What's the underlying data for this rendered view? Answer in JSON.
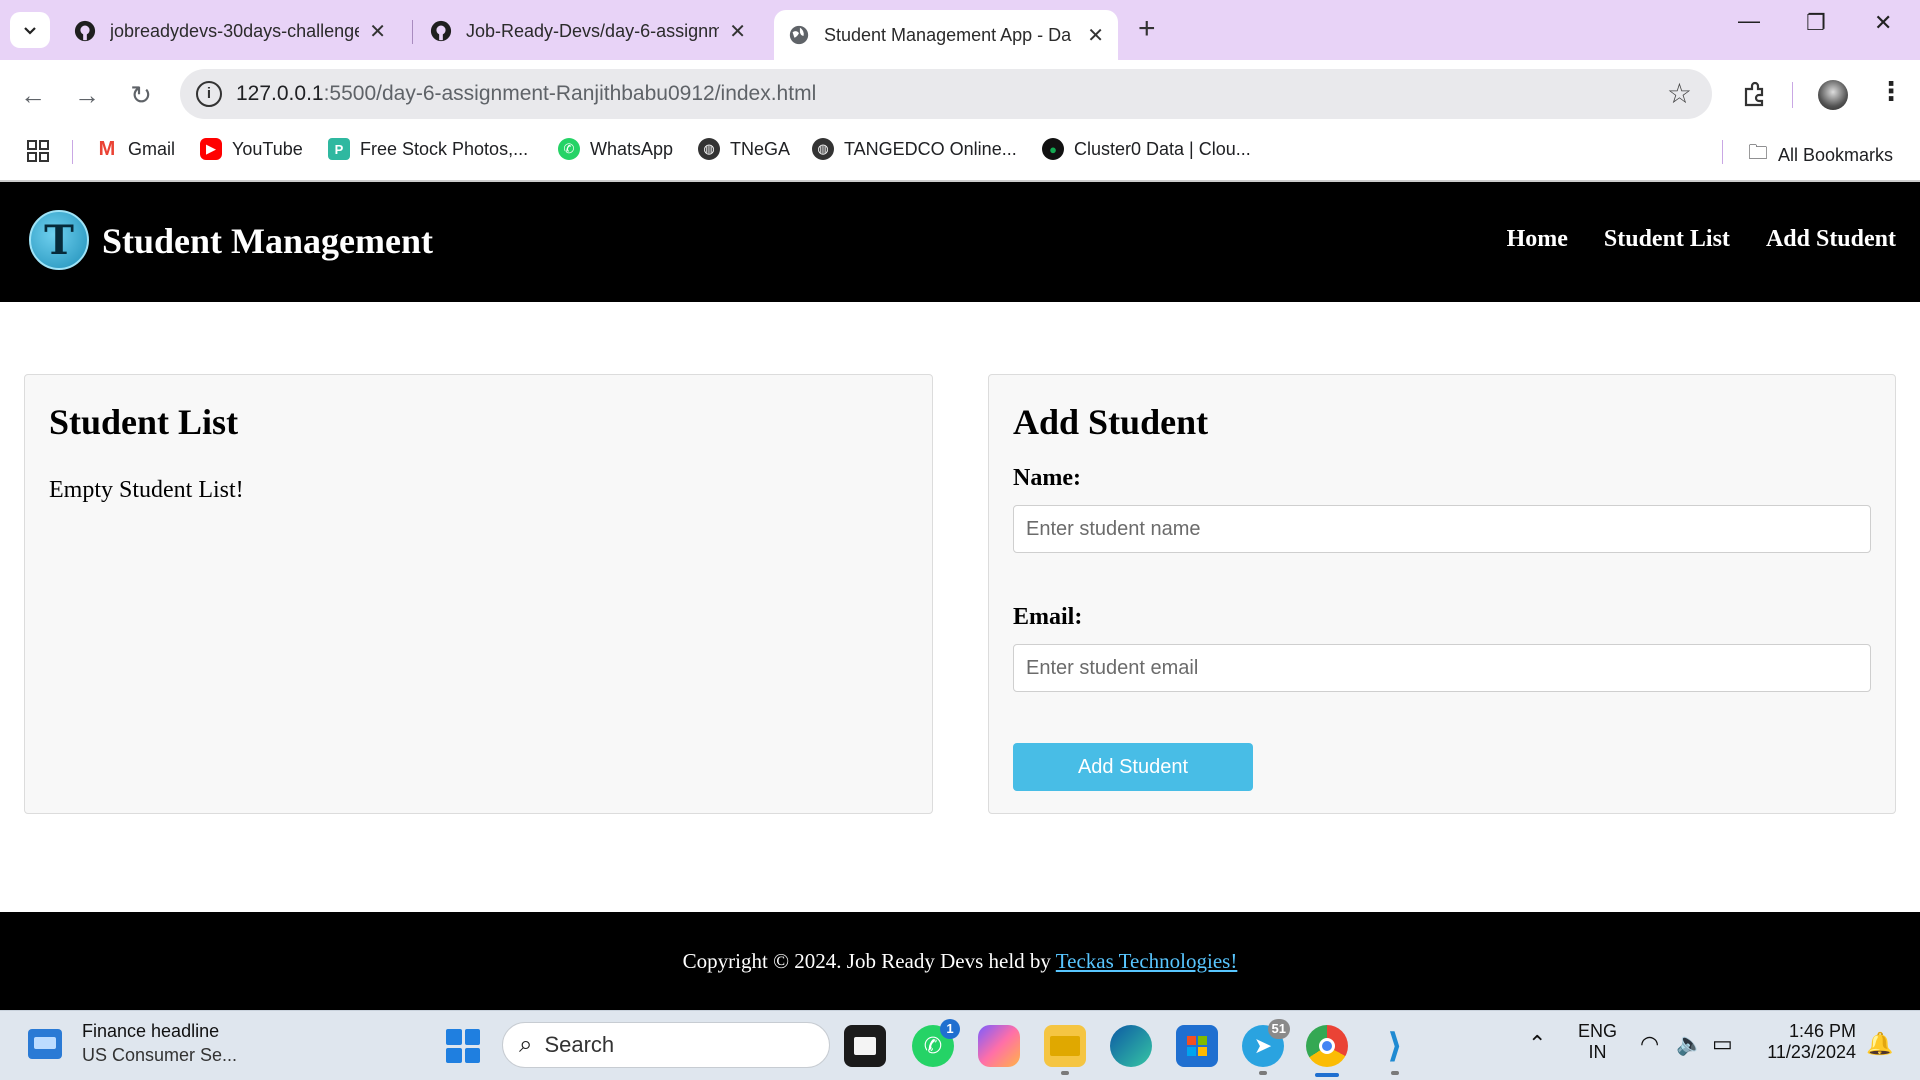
{
  "browser": {
    "tabs": [
      {
        "title": "jobreadydevs-30days-challenge",
        "active": false
      },
      {
        "title": "Job-Ready-Devs/day-6-assignm",
        "active": false
      },
      {
        "title": "Student Management App - Da",
        "active": true
      }
    ],
    "new_tab": "+",
    "window_controls": {
      "minimize": "—",
      "restore": "❐",
      "close": "✕"
    },
    "url_host": "127.0.0.1",
    "url_path": ":5500/day-6-assignment-Ranjithbabu0912/index.html",
    "bookmarks": [
      {
        "label": "Gmail",
        "icon": "gmail-icon",
        "color": "#ea4335"
      },
      {
        "label": "YouTube",
        "icon": "youtube-icon",
        "color": "#ff0000"
      },
      {
        "label": "Free Stock Photos,...",
        "icon": "stock-photos-icon",
        "color": "#2fb8a0"
      },
      {
        "label": "WhatsApp",
        "icon": "whatsapp-icon",
        "color": "#25d366"
      },
      {
        "label": "TNeGA",
        "icon": "globe-icon",
        "color": "#333333"
      },
      {
        "label": "TANGEDCO Online...",
        "icon": "globe-icon",
        "color": "#333333"
      },
      {
        "label": "Cluster0 Data | Clou...",
        "icon": "mongodb-icon",
        "color": "#13aa52"
      }
    ],
    "all_bookmarks": "All Bookmarks"
  },
  "page": {
    "brand": "Student Management",
    "logo_letter": "T",
    "nav": [
      "Home",
      "Student List",
      "Add Student"
    ],
    "list_card": {
      "title": "Student List",
      "empty_message": "Empty Student List!"
    },
    "form_card": {
      "title": "Add Student",
      "name_label": "Name:",
      "name_placeholder": "Enter student name",
      "email_label": "Email:",
      "email_placeholder": "Enter student email",
      "submit_label": "Add Student"
    },
    "footer": {
      "text": "Copyright © 2024. Job Ready Devs held by ",
      "link": "Teckas Technologies!"
    },
    "colors": {
      "accent": "#48bde6",
      "header_bg": "#000000"
    }
  },
  "taskbar": {
    "news_title": "Finance headline",
    "news_subtitle": "US Consumer Se...",
    "search_placeholder": "Search",
    "whatsapp_badge": "1",
    "telegram_badge": "51",
    "lang_top": "ENG",
    "lang_bottom": "IN",
    "time": "1:46 PM",
    "date": "11/23/2024"
  }
}
